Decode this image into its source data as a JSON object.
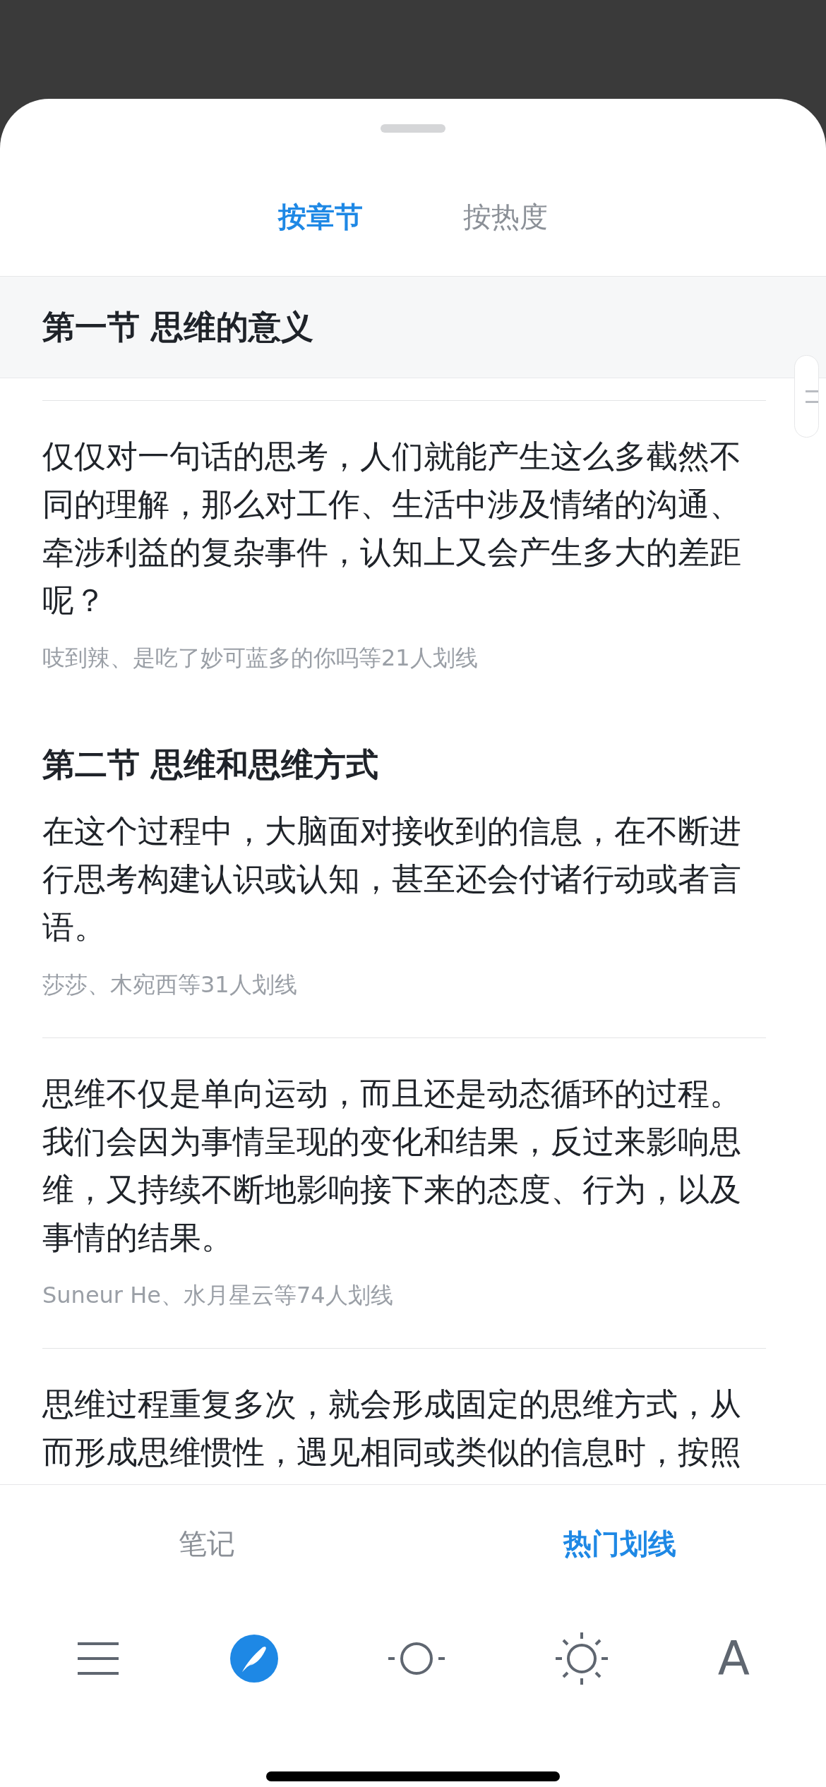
{
  "tabs": [
    {
      "label": "按章节",
      "selected": true
    },
    {
      "label": "按热度",
      "selected": false
    }
  ],
  "sticky_header": {
    "title": "第一节 思维的意义"
  },
  "entries": [
    {
      "kind": "highlight",
      "text": "仅仅对一句话的思考，人们就能产生这么多截然不同的理解，那么对工作、生活中涉及情绪的沟通、牵涉利益的复杂事件，认知上又会产生多大的差距呢？",
      "readers": "吱到辣、是吃了妙可蓝多的你吗等21人划线"
    },
    {
      "kind": "section",
      "title": "第二节 思维和思维方式"
    },
    {
      "kind": "highlight",
      "text": "在这个过程中，大脑面对接收到的信息，在不断进行思考构建认识或认知，甚至还会付诸行动或者言语。",
      "readers": "莎莎、木宛西等31人划线"
    },
    {
      "kind": "highlight",
      "text": "思维不仅是单向运动，而且还是动态循环的过程。我们会因为事情呈现的变化和结果，反过来影响思维，又持续不断地影响接下来的态度、行为，以及事情的结果。",
      "readers": "Suneur He、水月星云等74人划线"
    },
    {
      "kind": "highlight",
      "text": "思维过程重复多次，就会形成固定的思维方式，从而形成思维惯性，遇见相同或类似的信息时，按照"
    }
  ],
  "panel_tabs": [
    {
      "label": "笔记",
      "selected": false
    },
    {
      "label": "热门划线",
      "selected": true
    }
  ],
  "toolbar": {
    "font_button": "A"
  }
}
